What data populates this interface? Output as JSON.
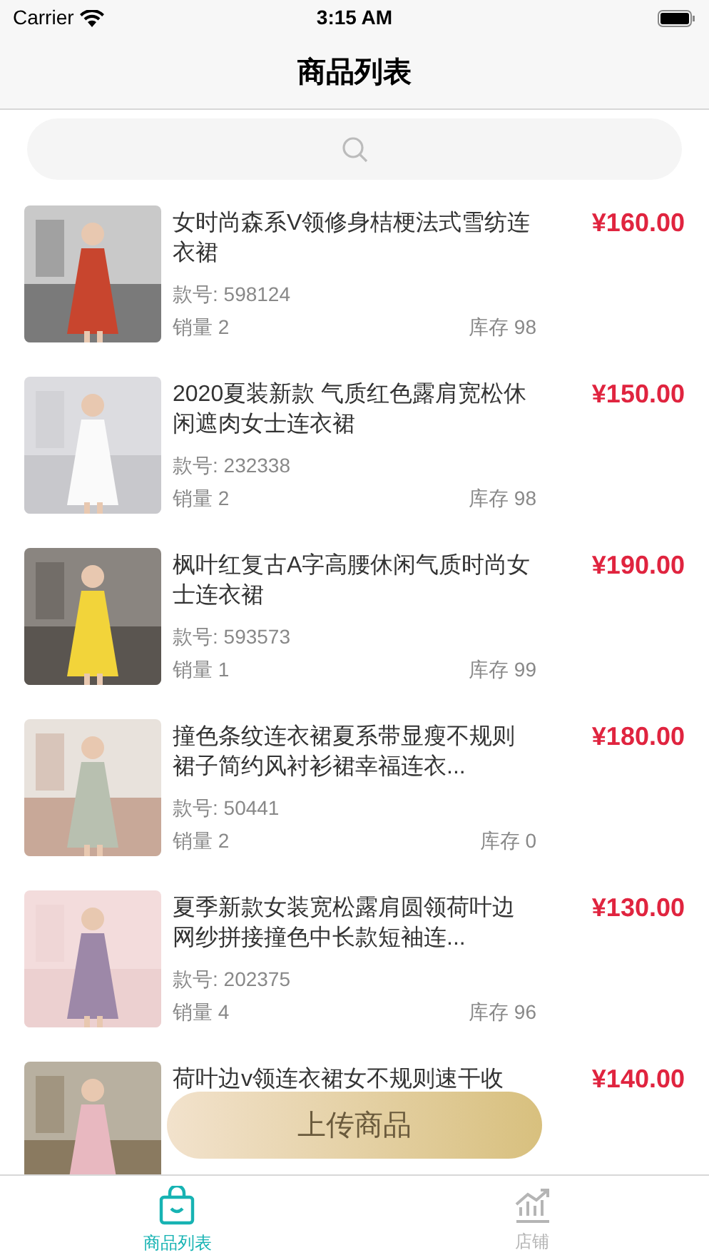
{
  "status_bar": {
    "carrier": "Carrier",
    "time": "3:15 AM"
  },
  "nav": {
    "title": "商品列表"
  },
  "products": [
    {
      "title": "女时尚森系V领修身桔梗法式雪纺连衣裙",
      "price": "¥160.00",
      "code": "款号:  598124",
      "sales": "销量 2",
      "stock": "库存 98",
      "kind": "red"
    },
    {
      "title": "2020夏装新款 气质红色露肩宽松休闲遮肉女士连衣裙",
      "price": "¥150.00",
      "code": "款号:  232338",
      "sales": "销量 2",
      "stock": "库存 98",
      "kind": "white"
    },
    {
      "title": "枫叶红复古A字高腰休闲气质时尚女士连衣裙",
      "price": "¥190.00",
      "code": "款号:  593573",
      "sales": "销量 1",
      "stock": "库存 99",
      "kind": "yellow"
    },
    {
      "title": "撞色条纹连衣裙夏系带显瘦不规则裙子简约风衬衫裙幸福连衣...",
      "price": "¥180.00",
      "code": "款号:  50441",
      "sales": "销量 2",
      "stock": "库存 0",
      "kind": "floral"
    },
    {
      "title": "夏季新款女装宽松露肩圆领荷叶边网纱拼接撞色中长款短袖连...",
      "price": "¥130.00",
      "code": "款号:  202375",
      "sales": "销量 4",
      "stock": "库存 96",
      "kind": "lilac"
    },
    {
      "title": "荷叶边v领连衣裙女不规则速干收",
      "price": "¥140.00",
      "kind": "pink"
    }
  ],
  "upload_button": {
    "label": "上传商品"
  },
  "tab_bar": [
    {
      "label": "商品列表",
      "selected": true,
      "kind": "bag"
    },
    {
      "label": "店铺",
      "selected": false,
      "kind": "chart"
    }
  ]
}
